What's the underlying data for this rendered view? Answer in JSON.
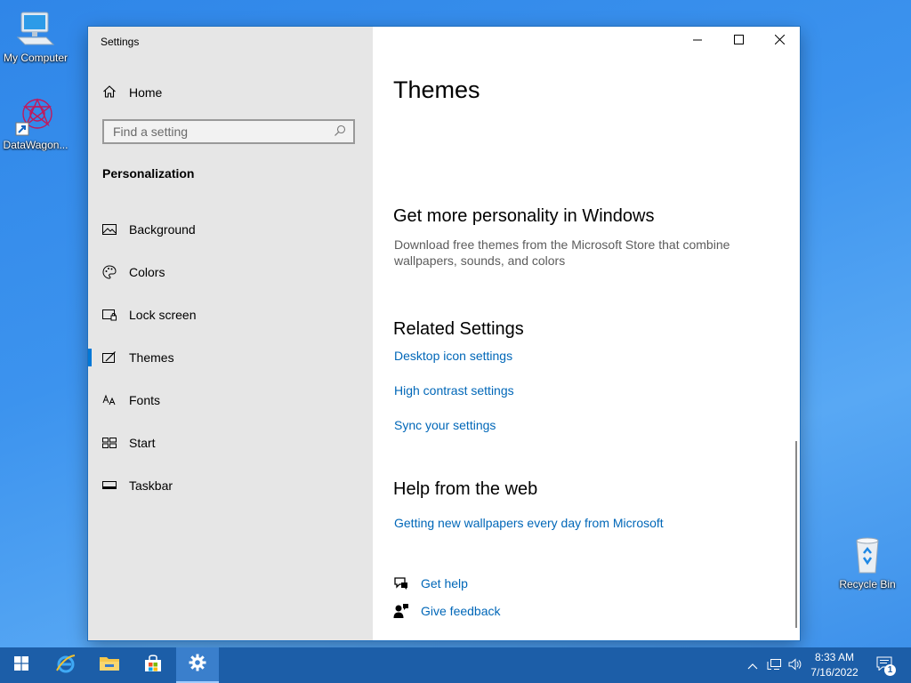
{
  "desktop": {
    "icons": [
      {
        "label": "My Computer"
      },
      {
        "label": "DataWagon..."
      },
      {
        "label": "Recycle Bin"
      }
    ]
  },
  "window": {
    "title": "Settings",
    "controls": {
      "minimize": "minimize-icon",
      "maximize": "maximize-icon",
      "close": "close-icon"
    }
  },
  "sidebar": {
    "home_label": "Home",
    "search_placeholder": "Find a setting",
    "section_title": "Personalization",
    "items": [
      {
        "label": "Background",
        "icon": "picture-icon"
      },
      {
        "label": "Colors",
        "icon": "palette-icon"
      },
      {
        "label": "Lock screen",
        "icon": "lock-screen-icon"
      },
      {
        "label": "Themes",
        "icon": "themes-icon",
        "active": true
      },
      {
        "label": "Fonts",
        "icon": "fonts-icon"
      },
      {
        "label": "Start",
        "icon": "start-icon"
      },
      {
        "label": "Taskbar",
        "icon": "taskbar-icon"
      }
    ]
  },
  "main": {
    "page_title": "Themes",
    "personality": {
      "heading": "Get more personality in Windows",
      "description": "Download free themes from the Microsoft Store that combine wallpapers, sounds, and colors"
    },
    "related": {
      "heading": "Related Settings",
      "links": [
        "Desktop icon settings",
        "High contrast settings",
        "Sync your settings"
      ]
    },
    "help_web": {
      "heading": "Help from the web",
      "link": "Getting new wallpapers every day from Microsoft"
    },
    "get_help": "Get help",
    "give_feedback": "Give feedback"
  },
  "taskbar": {
    "time": "8:33 AM",
    "date": "7/16/2022",
    "notification_count": "1",
    "accent": "#0078d7"
  }
}
